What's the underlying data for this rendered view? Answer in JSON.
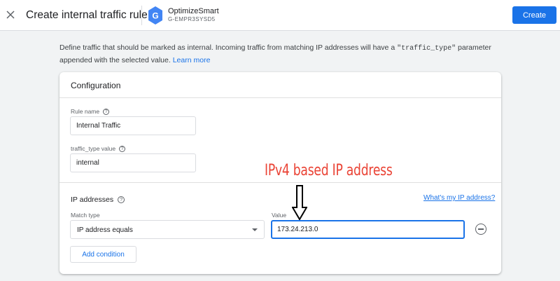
{
  "header": {
    "title": "Create internal traffic rule",
    "property_name": "OptimizeSmart",
    "property_id": "G-EMPR3SYSD5",
    "create_label": "Create",
    "close_icon": "close-icon",
    "logo_icon": "google-analytics-icon"
  },
  "description": {
    "text_before": "Define traffic that should be marked as internal. Incoming traffic from matching IP addresses will have a ",
    "code": "\"traffic_type\"",
    "text_after": " parameter appended with the selected value.",
    "link": "Learn more"
  },
  "config": {
    "title": "Configuration",
    "rule_name_label": "Rule name",
    "rule_name_value": "Internal Traffic",
    "traffic_type_label": "traffic_type value",
    "traffic_type_value": "internal",
    "help_icon_glyph": "?"
  },
  "ip": {
    "section_title": "IP addresses",
    "whats_my_ip": "What's my IP address?",
    "match_type_label": "Match type",
    "match_type_value": "IP address equals",
    "value_label": "Value",
    "value": "173.24.213.0",
    "remove_icon": "remove-circle-icon",
    "add_condition": "Add condition"
  },
  "annotation": {
    "text": "IPv4 based IP address",
    "color": "#ea4335"
  },
  "colors": {
    "accent": "#1a73e8",
    "background": "#f1f3f4"
  }
}
